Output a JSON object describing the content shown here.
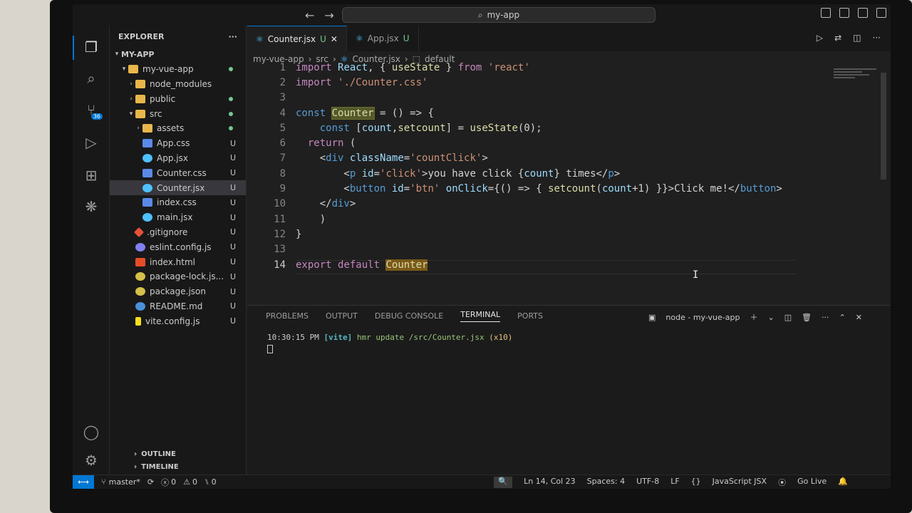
{
  "titlebar": {
    "search_text": "my-app",
    "back": "←",
    "forward": "→"
  },
  "activity": {
    "scm_badge": "36"
  },
  "explorer": {
    "title": "EXPLORER",
    "more": "···",
    "root": "MY-APP",
    "items": [
      {
        "label": "my-vue-app",
        "depth": 1,
        "type": "folder-open",
        "status": "dot"
      },
      {
        "label": "node_modules",
        "depth": 2,
        "type": "folder",
        "status": ""
      },
      {
        "label": "public",
        "depth": 2,
        "type": "folder",
        "status": "dot"
      },
      {
        "label": "src",
        "depth": 2,
        "type": "folder-open",
        "status": "dot"
      },
      {
        "label": "assets",
        "depth": 3,
        "type": "folder",
        "status": "dot"
      },
      {
        "label": "App.css",
        "depth": 3,
        "type": "css",
        "status": "U"
      },
      {
        "label": "App.jsx",
        "depth": 3,
        "type": "jsx",
        "status": "U"
      },
      {
        "label": "Counter.css",
        "depth": 3,
        "type": "css",
        "status": "U"
      },
      {
        "label": "Counter.jsx",
        "depth": 3,
        "type": "jsx",
        "status": "U"
      },
      {
        "label": "index.css",
        "depth": 3,
        "type": "css",
        "status": "U"
      },
      {
        "label": "main.jsx",
        "depth": 3,
        "type": "jsx",
        "status": "U"
      },
      {
        "label": ".gitignore",
        "depth": 2,
        "type": "git",
        "status": "U"
      },
      {
        "label": "eslint.config.js",
        "depth": 2,
        "type": "eslint",
        "status": "U"
      },
      {
        "label": "index.html",
        "depth": 2,
        "type": "html",
        "status": "U"
      },
      {
        "label": "package-lock.js...",
        "depth": 2,
        "type": "json",
        "status": "U"
      },
      {
        "label": "package.json",
        "depth": 2,
        "type": "json",
        "status": "U"
      },
      {
        "label": "README.md",
        "depth": 2,
        "type": "md",
        "status": "U"
      },
      {
        "label": "vite.config.js",
        "depth": 2,
        "type": "js",
        "status": "U"
      }
    ],
    "outline": "OUTLINE",
    "timeline": "TIMELINE"
  },
  "tabs": [
    {
      "label": "Counter.jsx",
      "status": "U",
      "active": true
    },
    {
      "label": "App.jsx",
      "status": "U",
      "active": false
    }
  ],
  "breadcrumb": [
    "my-vue-app",
    "src",
    "Counter.jsx",
    "default"
  ],
  "code": [
    {
      "n": "1",
      "text": "import React, { useState } from 'react'"
    },
    {
      "n": "2",
      "text": "import './Counter.css'"
    },
    {
      "n": "3",
      "text": ""
    },
    {
      "n": "4",
      "text": "const Counter = () => {"
    },
    {
      "n": "5",
      "text": "    const [count,setcount] = useState(0);"
    },
    {
      "n": "6",
      "text": "  return ("
    },
    {
      "n": "7",
      "text": "    <div className='countClick'>"
    },
    {
      "n": "8",
      "text": "        <p id='click'>you have click {count} times</p>"
    },
    {
      "n": "9",
      "text": "        <button id='btn' onClick={() => { setcount(count+1) }}>Click me!</button>"
    },
    {
      "n": "10",
      "text": "    </div>"
    },
    {
      "n": "11",
      "text": "    )"
    },
    {
      "n": "12",
      "text": "}"
    },
    {
      "n": "13",
      "text": ""
    },
    {
      "n": "14",
      "text": "export default Counter"
    }
  ],
  "panel": {
    "tabs": [
      "PROBLEMS",
      "OUTPUT",
      "DEBUG CONSOLE",
      "TERMINAL",
      "PORTS"
    ],
    "active_tab": "TERMINAL",
    "terminal_name": "node - my-vue-app",
    "term_time": "10:30:15 PM",
    "term_tag": "[vite]",
    "term_msg": "hmr update /src/Counter.jsx",
    "term_count": "(x10)"
  },
  "status": {
    "branch": "master*",
    "errors": "0",
    "warnings": "0",
    "ports": "0",
    "position": "Ln 14, Col 23",
    "spaces": "Spaces: 4",
    "encoding": "UTF-8",
    "eol": "LF",
    "language": "JavaScript JSX",
    "golive": "Go Live"
  }
}
